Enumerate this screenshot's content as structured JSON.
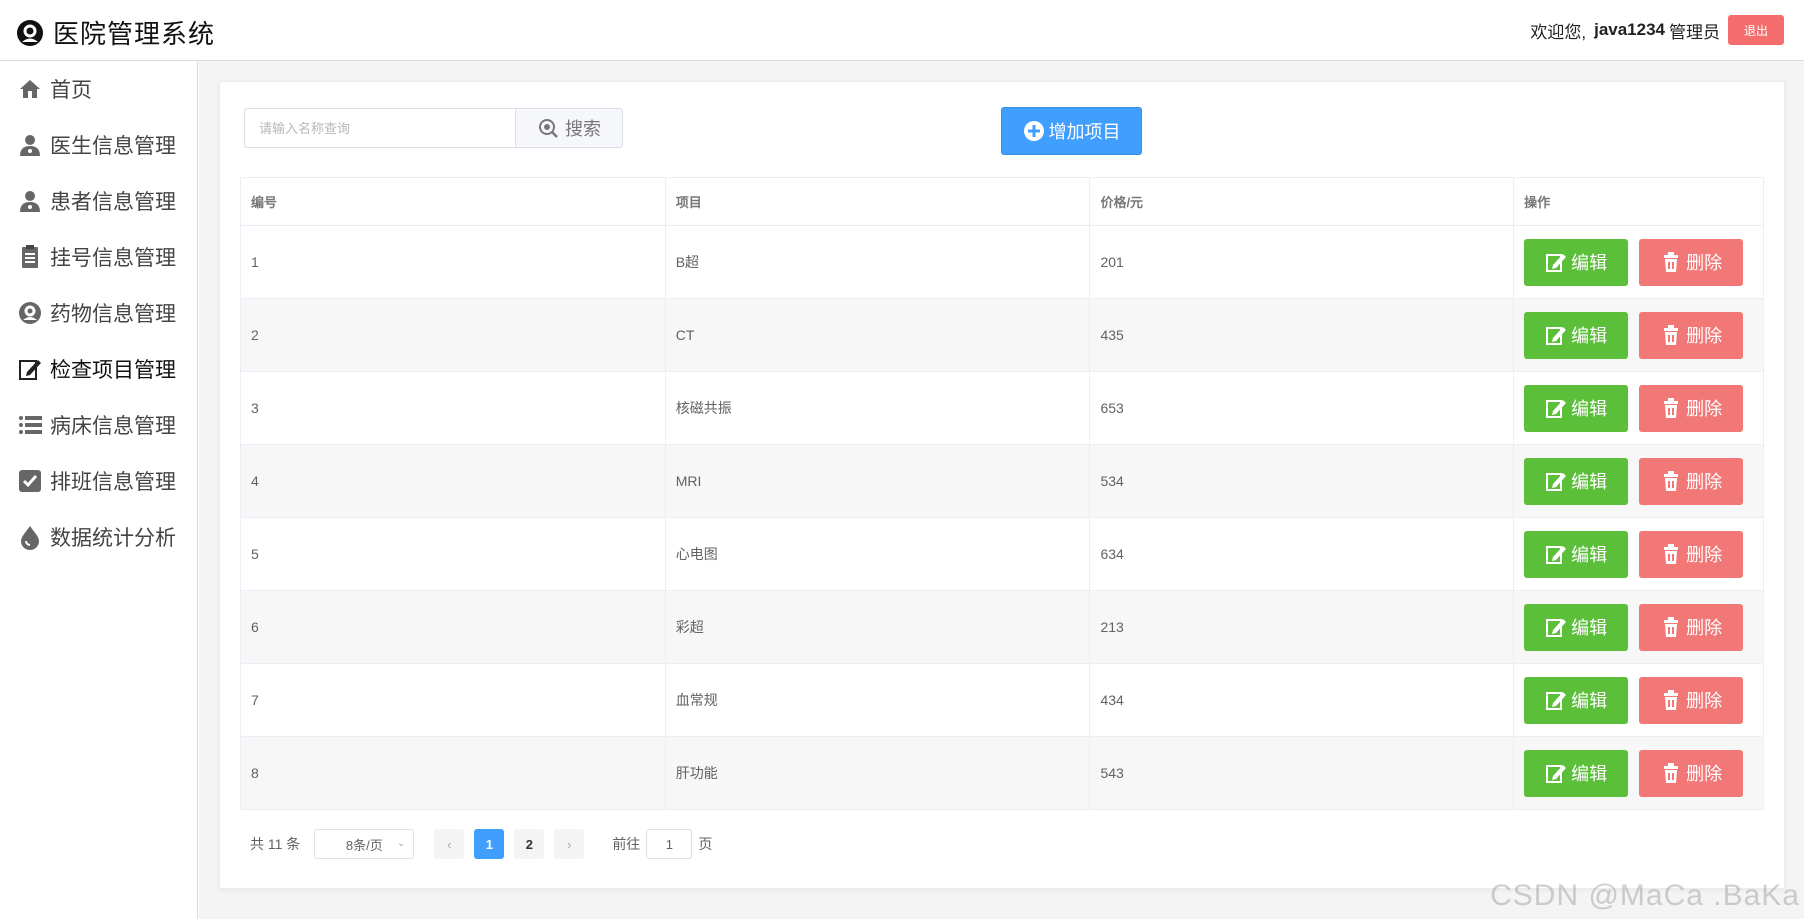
{
  "header": {
    "title": "医院管理系统",
    "welcome": "欢迎您,",
    "username": "java1234",
    "role": "管理员",
    "logout": "退出"
  },
  "sidebar": {
    "items": [
      {
        "label": "首页",
        "icon": "home-icon"
      },
      {
        "label": "医生信息管理",
        "icon": "user-icon"
      },
      {
        "label": "患者信息管理",
        "icon": "user-icon"
      },
      {
        "label": "挂号信息管理",
        "icon": "clipboard-icon"
      },
      {
        "label": "药物信息管理",
        "icon": "medicine-icon"
      },
      {
        "label": "检查项目管理",
        "icon": "edit-icon",
        "active": true
      },
      {
        "label": "病床信息管理",
        "icon": "list-icon"
      },
      {
        "label": "排班信息管理",
        "icon": "checkbox-icon"
      },
      {
        "label": "数据统计分析",
        "icon": "drop-icon"
      }
    ]
  },
  "toolbar": {
    "search_placeholder": "请输入名称查询",
    "search_label": "搜索",
    "add_label": "增加项目"
  },
  "table": {
    "columns": [
      "编号",
      "项目",
      "价格/元",
      "操作"
    ],
    "rows": [
      {
        "id": "1",
        "name": "B超",
        "price": "201"
      },
      {
        "id": "2",
        "name": "CT",
        "price": "435"
      },
      {
        "id": "3",
        "name": "核磁共振",
        "price": "653"
      },
      {
        "id": "4",
        "name": "MRI",
        "price": "534"
      },
      {
        "id": "5",
        "name": "心电图",
        "price": "634"
      },
      {
        "id": "6",
        "name": "彩超",
        "price": "213"
      },
      {
        "id": "7",
        "name": "血常规",
        "price": "434"
      },
      {
        "id": "8",
        "name": "肝功能",
        "price": "543"
      }
    ],
    "edit_label": "编辑",
    "delete_label": "删除"
  },
  "pagination": {
    "total": "共 11 条",
    "page_size": "8条/页",
    "pages": [
      "1",
      "2"
    ],
    "current": "1",
    "goto_prefix": "前往",
    "goto_value": "1",
    "goto_suffix": "页"
  },
  "watermark": "CSDN @MaCa .BaKa",
  "colors": {
    "primary": "#409eff",
    "success": "#5cbf3a",
    "danger": "#f27777"
  }
}
